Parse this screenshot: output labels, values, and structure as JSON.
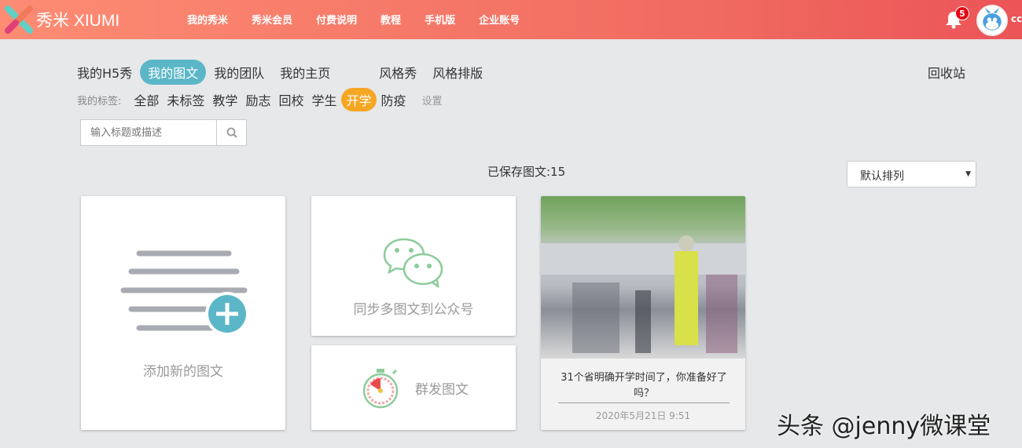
{
  "header": {
    "logo": "秀米 XIUMI",
    "nav": [
      "我的秀米",
      "秀米会员",
      "付费说明",
      "教程",
      "手机版",
      "企业账号"
    ],
    "notification_count": "5",
    "username": "cc"
  },
  "tabs": [
    "我的H5秀",
    "我的图文",
    "我的团队",
    "我的主页",
    "风格秀",
    "风格排版"
  ],
  "recycle": "回收站",
  "tags": {
    "label": "我的标签:",
    "items": [
      "全部",
      "未标签",
      "教学",
      "励志",
      "回校",
      "学生",
      "开学",
      "防疫"
    ],
    "settings": "设置"
  },
  "search": {
    "placeholder": "输入标题或描述"
  },
  "saved_count": "已保存图文:15",
  "sort": {
    "selected": "默认排列"
  },
  "cards": {
    "add": "添加新的图文",
    "sync": "同步多图文到公众号",
    "mass": "群发图文",
    "article": {
      "title": "31个省明确开学时间了，你准备好了吗？",
      "date": "2020年5月21日 9:51"
    }
  },
  "watermark": "头条 @jenny微课堂",
  "colors": {
    "accent": "#5bb7c8",
    "tag_active": "#f5a623"
  }
}
